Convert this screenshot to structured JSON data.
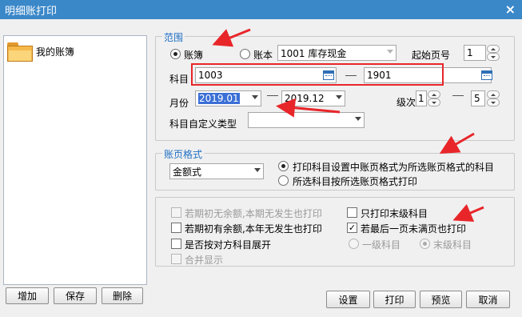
{
  "window": {
    "title": "明细账打印",
    "close_label": "×"
  },
  "left_panel": {
    "books": [
      {
        "label": "我的账簿"
      }
    ],
    "buttons": {
      "add": "增加",
      "save": "保存",
      "delete": "删除"
    }
  },
  "range": {
    "legend": "范围",
    "radio_ledger": {
      "label": "账簿",
      "checked": true
    },
    "radio_account": {
      "label": "账本",
      "checked": false
    },
    "account_select": "1001 库存现金",
    "start_page_label": "起始页号",
    "start_page_value": "1",
    "subject_label": "科目",
    "subject_from": "1003",
    "subject_to": "1901",
    "month_label": "月份",
    "month_from": "2019.01",
    "month_to": "2019.12",
    "level_label": "级次",
    "level_from": "1",
    "level_to": "5",
    "custom_type_label": "科目自定义类型",
    "custom_type_value": ""
  },
  "page_format": {
    "legend": "账页格式",
    "format_select": "金额式",
    "option1": "打印科目设置中账页格式为所选账页格式的科目",
    "option2": "所选科目按所选账页格式打印"
  },
  "options": {
    "opt_no_balance_no_occur": "若期初无余额,本期无发生也打印",
    "opt_last_level_only": "只打印末级科目",
    "opt_balance_no_occur": "若期初有余额,本年无发生也打印",
    "opt_last_page": "若最后一页未满页也打印",
    "opt_expand_counter": "是否按对方科目展开",
    "opt_first_level": "一级科目",
    "opt_last_level": "末级科目",
    "opt_merge": "合并显示",
    "last_page_checked": "✓"
  },
  "footer": {
    "settings": "设置",
    "print": "打印",
    "preview": "预览",
    "cancel": "取消"
  },
  "colors": {
    "titlebar": "#3b88c9",
    "legend": "#1f6fc4",
    "annotation": "#e8262a"
  }
}
